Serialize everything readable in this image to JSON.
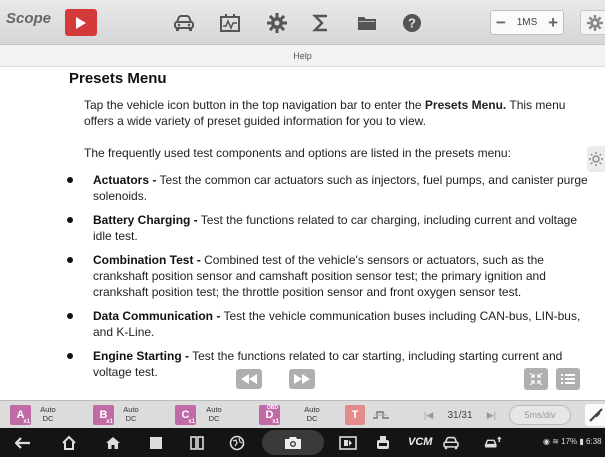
{
  "app": {
    "logo": "Scope"
  },
  "toolbar": {
    "zoom_minus": "−",
    "zoom_value": "1MS",
    "zoom_plus": "+"
  },
  "help_title": "Help",
  "doc": {
    "heading": "Presets Menu",
    "intro_1": "Tap the vehicle icon button in the top navigation bar to enter the ",
    "intro_1_bold": "Presets Menu.",
    "intro_2": " This menu offers a wide variety of preset guided information for you to view.",
    "intro_3": "The frequently used test components and options are listed in the presets menu:",
    "items": [
      {
        "title": "Actuators -",
        "text": " Test the common car actuators such as injectors, fuel pumps, and canister purge solenoids."
      },
      {
        "title": "Battery Charging -",
        "text": " Test the functions related to car charging, including current and voltage idle test."
      },
      {
        "title": "Combination Test -",
        "text": " Combined test of the vehicle's sensors or actuators, such as the crankshaft position sensor and camshaft position sensor test; the primary ignition and crankshaft position test; the throttle position sensor and front oxygen sensor test."
      },
      {
        "title": "Data Communication -",
        "text": " Test the vehicle communication buses including CAN-bus, LIN-bus, and K-Line."
      },
      {
        "title": "Engine Starting -",
        "text": " Test the functions related to car starting, including starting current and voltage test."
      }
    ]
  },
  "channels": [
    {
      "letter": "A",
      "sub": "x1",
      "sup": "",
      "color": "#c06aa6",
      "mode_1": "Auto",
      "mode_2": "DC"
    },
    {
      "letter": "B",
      "sub": "x1",
      "sup": "",
      "color": "#c06aa6",
      "mode_1": "Auto",
      "mode_2": "DC"
    },
    {
      "letter": "C",
      "sub": "x1",
      "sup": "",
      "color": "#c06aa6",
      "mode_1": "Auto",
      "mode_2": "DC"
    },
    {
      "letter": "D",
      "sub": "x1",
      "sup": "OBD",
      "color": "#c06aa6",
      "mode_1": "Auto",
      "mode_2": "DC"
    }
  ],
  "trigger": {
    "label": "T"
  },
  "pager": {
    "prev": "|◀",
    "value": "31/31",
    "next": "▶|"
  },
  "timebase": "5ms/div",
  "sysbar": {
    "vcm": "VCM",
    "status": "17%",
    "time": "6:38"
  },
  "colors": {
    "accent": "#d53a3a",
    "channel": "#c06aa6",
    "trigger": "#e38b8b"
  }
}
